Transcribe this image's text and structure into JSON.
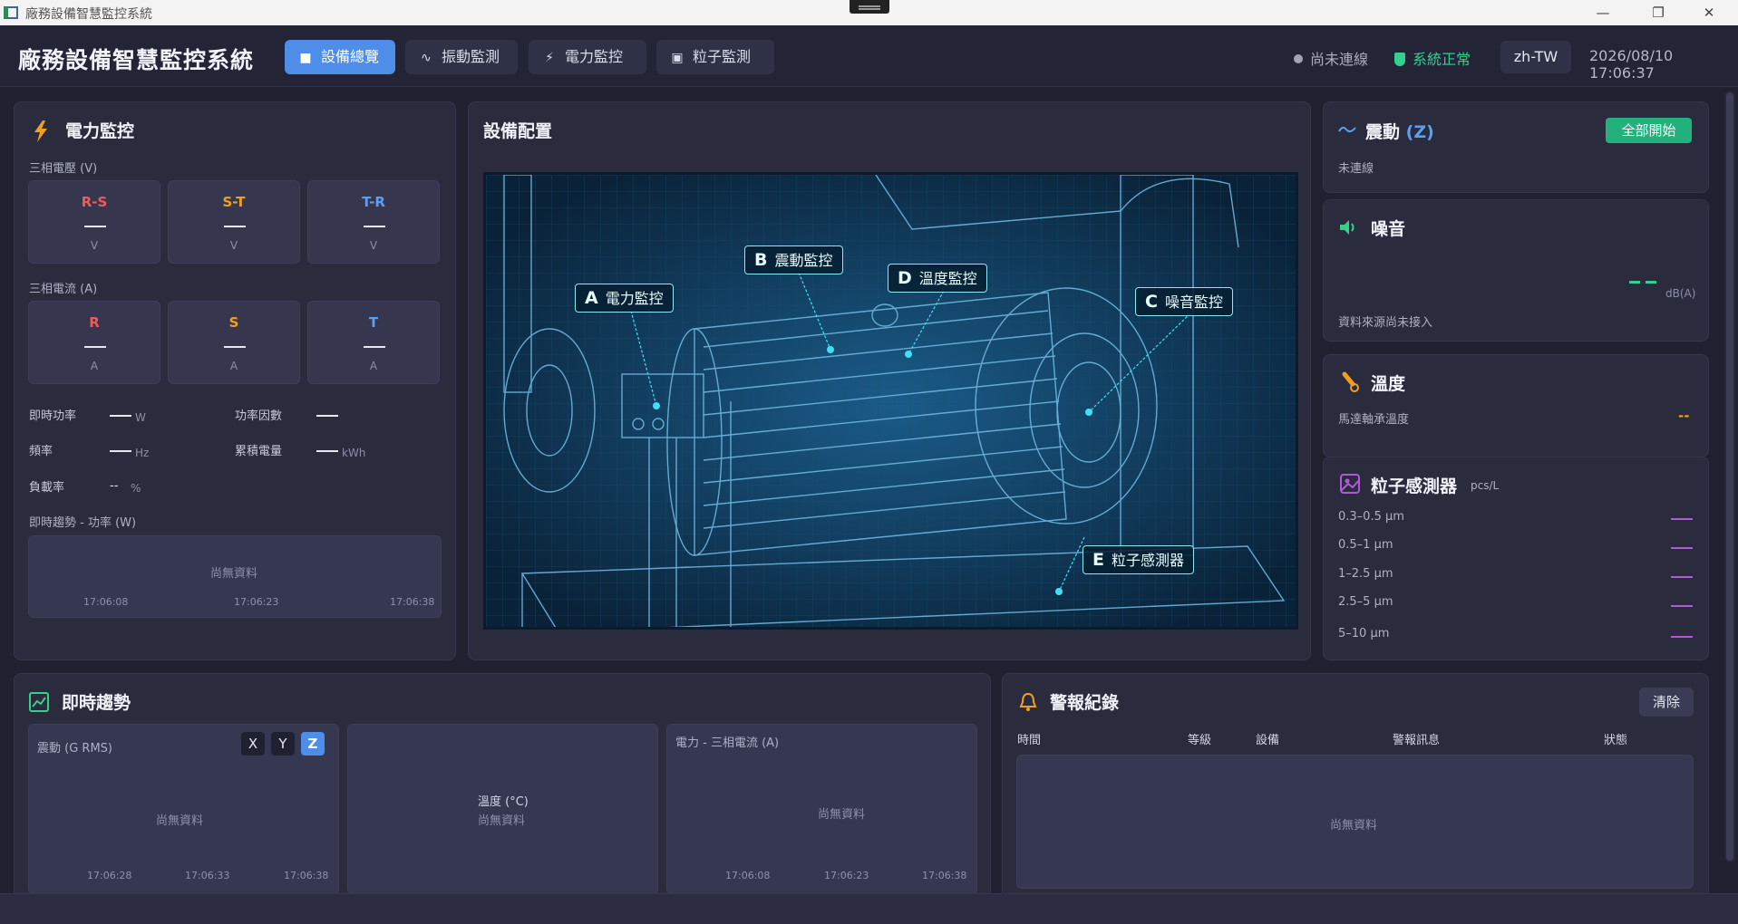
{
  "window": {
    "title": "廠務設備智慧監控系統"
  },
  "header": {
    "title": "廠務設備智慧監控系統",
    "tabs": [
      {
        "label": "設備總覽",
        "icon": "overview-icon",
        "active": true
      },
      {
        "label": "振動監測",
        "icon": "wave-icon",
        "active": false
      },
      {
        "label": "電力監控",
        "icon": "bolt-icon",
        "active": false
      },
      {
        "label": "粒子監測",
        "icon": "image-icon",
        "active": false
      }
    ],
    "connection": "尚未連線",
    "system_status": "系統正常",
    "language": "zh-TW",
    "datetime": "2026/08/10 17:06:37"
  },
  "power": {
    "title": "電力監控",
    "voltage_label": "三相電壓 (V)",
    "voltage": [
      {
        "name": "R-S",
        "unit": "V",
        "color": "#f05a5a"
      },
      {
        "name": "S-T",
        "unit": "V",
        "color": "#f0a020"
      },
      {
        "name": "T-R",
        "unit": "V",
        "color": "#5aa0f0"
      }
    ],
    "current_label": "三相電流 (A)",
    "current": [
      {
        "name": "R",
        "unit": "A",
        "color": "#f05a5a"
      },
      {
        "name": "S",
        "unit": "A",
        "color": "#f0a020"
      },
      {
        "name": "T",
        "unit": "A",
        "color": "#5aa0f0"
      }
    ],
    "metrics": {
      "power_label": "即時功率",
      "power_unit": "W",
      "pf_label": "功率因數",
      "freq_label": "頻率",
      "freq_unit": "Hz",
      "energy_label": "累積電量",
      "energy_unit": "kWh",
      "load_label": "負載率",
      "load_value": "--",
      "load_unit": "%"
    },
    "trend_label": "即時趨勢 - 功率 (W)",
    "trend_nodata": "尚無資料",
    "trend_ticks": [
      "17:06:08",
      "17:06:23",
      "17:06:38"
    ]
  },
  "equipment": {
    "title": "設備配置",
    "callouts": [
      {
        "letter": "A",
        "label": "電力監控"
      },
      {
        "letter": "B",
        "label": "震動監控"
      },
      {
        "letter": "D",
        "label": "溫度監控"
      },
      {
        "letter": "C",
        "label": "噪音監控"
      },
      {
        "letter": "E",
        "label": "粒子感測器"
      }
    ]
  },
  "vibration_card": {
    "title": "震動",
    "axis": "(Z)",
    "start_label": "全部開始",
    "status": "未連線"
  },
  "noise_card": {
    "title": "噪音",
    "unit": "dB(A)",
    "source": "資料來源尚未接入"
  },
  "temp_card": {
    "title": "溫度",
    "label": "馬達軸承溫度",
    "value": "--"
  },
  "particle_card": {
    "title": "粒子感測器",
    "unit": "pcs/L",
    "bins": [
      "0.3–0.5 μm",
      "0.5–1 μm",
      "1–2.5 μm",
      "2.5–5 μm",
      "5–10 μm"
    ]
  },
  "trends": {
    "title": "即時趨勢",
    "vibration": {
      "label": "震動 (G RMS)",
      "axes": [
        "X",
        "Y",
        "Z"
      ],
      "active_axis": "Z",
      "nodata": "尚無資料",
      "ticks": [
        "17:06:28",
        "17:06:33",
        "17:06:38"
      ]
    },
    "temperature": {
      "label": "溫度 (°C)",
      "nodata": "尚無資料"
    },
    "current": {
      "label": "電力 - 三相電流 (A)",
      "nodata": "尚無資料",
      "ticks": [
        "17:06:08",
        "17:06:23",
        "17:06:38"
      ]
    }
  },
  "alarms": {
    "title": "警報紀錄",
    "clear_label": "清除",
    "columns": [
      "時間",
      "等級",
      "設備",
      "警報訊息",
      "狀態"
    ],
    "nodata": "尚無資料"
  }
}
